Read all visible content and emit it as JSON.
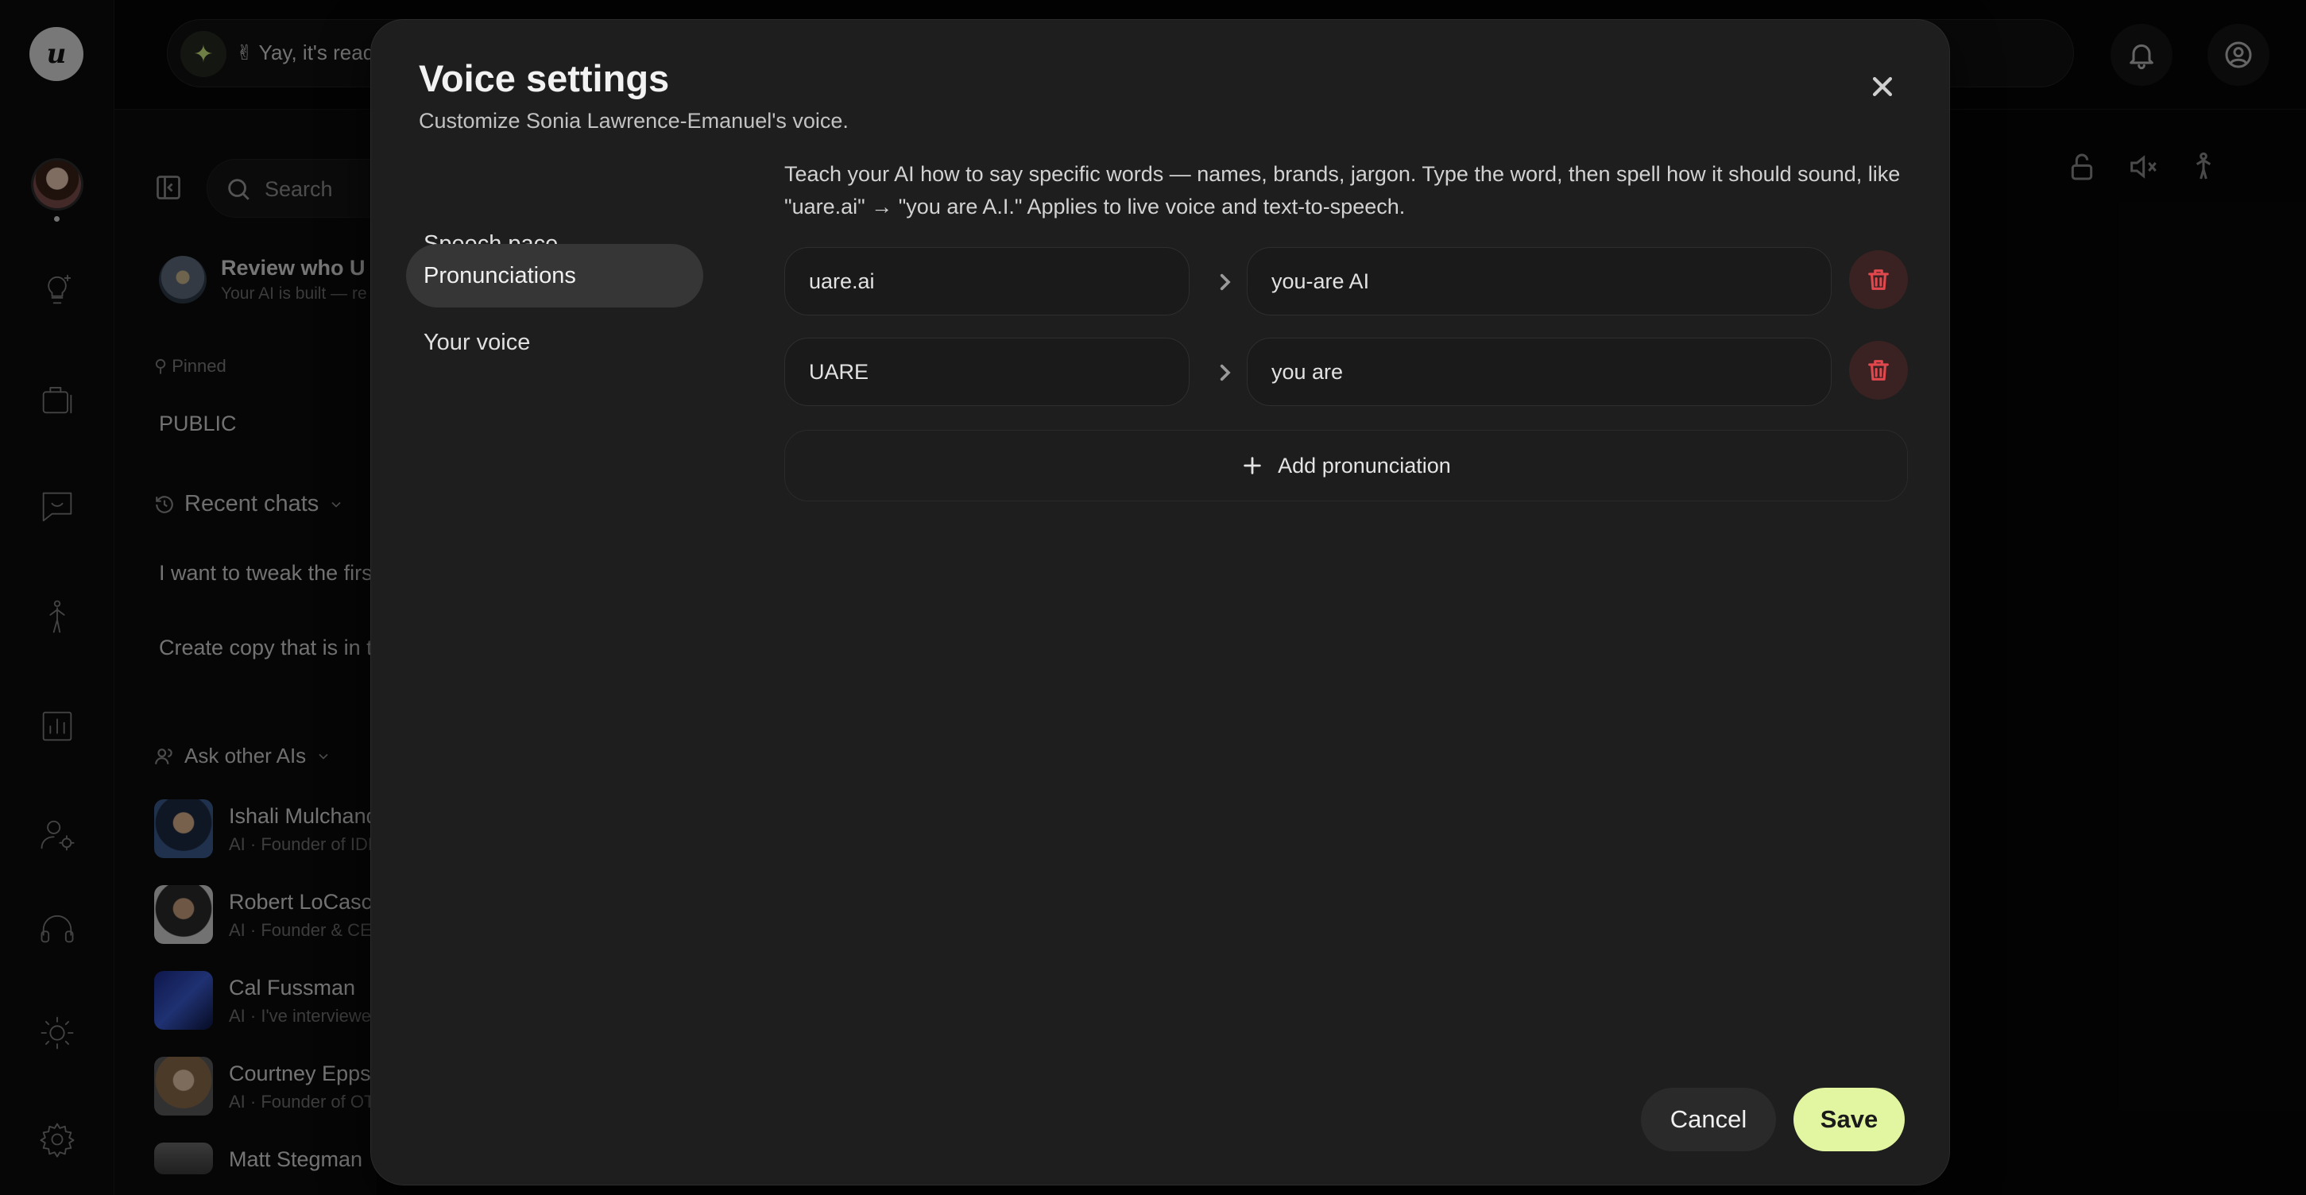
{
  "topbar": {
    "banner_text": "✌ Yay, it's read",
    "notifications_icon": "bell-icon",
    "profile_icon": "user-circle-icon"
  },
  "rail": {
    "logo_text": "u",
    "icons": [
      "lightbulb-icon",
      "briefcase-icon",
      "chat-smile-icon",
      "figure-icon",
      "chart-icon",
      "user-gear-icon",
      "headphones-icon",
      "sun-icon",
      "gear-icon"
    ]
  },
  "sidebar": {
    "search_placeholder": "Search",
    "review_title": "Review who U a",
    "review_subtitle": "Your AI is built — re",
    "pinned_label": "Pinned",
    "pinned_item": "PUBLIC",
    "recent_chats_label": "Recent chats",
    "chats": [
      "I want to tweak the firs",
      "Create copy that is in t"
    ],
    "ask_other_label": "Ask other AIs",
    "people": [
      {
        "name": "Ishali Mulchand",
        "desc": "AI · Founder of IDN"
      },
      {
        "name": "Robert LoCasci",
        "desc": "AI · Founder & CE"
      },
      {
        "name": "Cal Fussman",
        "desc": "AI · I've interviewe"
      },
      {
        "name": "Courtney Epps",
        "desc": "AI · Founder of OT"
      },
      {
        "name": "Matt Stegman",
        "desc": ""
      }
    ]
  },
  "modal": {
    "title": "Voice settings",
    "subtitle": "Customize Sonia Lawrence-Emanuel's voice.",
    "nav": [
      {
        "label": "Speech pace",
        "active": false
      },
      {
        "label": "Pronunciations",
        "active": true
      },
      {
        "label": "Your voice",
        "active": false
      }
    ],
    "description": "Teach your AI how to say specific words — names, brands, jargon. Type the word, then spell how it should sound, like \"uare.ai\" → \"you are A.I.\" Applies to live voice and text-to-speech.",
    "pronunciations": [
      {
        "word": "uare.ai",
        "sounds_like": "you-are AI"
      },
      {
        "word": "UARE",
        "sounds_like": "you are"
      }
    ],
    "add_label": "Add pronunciation",
    "cancel_label": "Cancel",
    "save_label": "Save",
    "colors": {
      "accent": "#e2f5a1",
      "danger": "#e0484e"
    }
  }
}
